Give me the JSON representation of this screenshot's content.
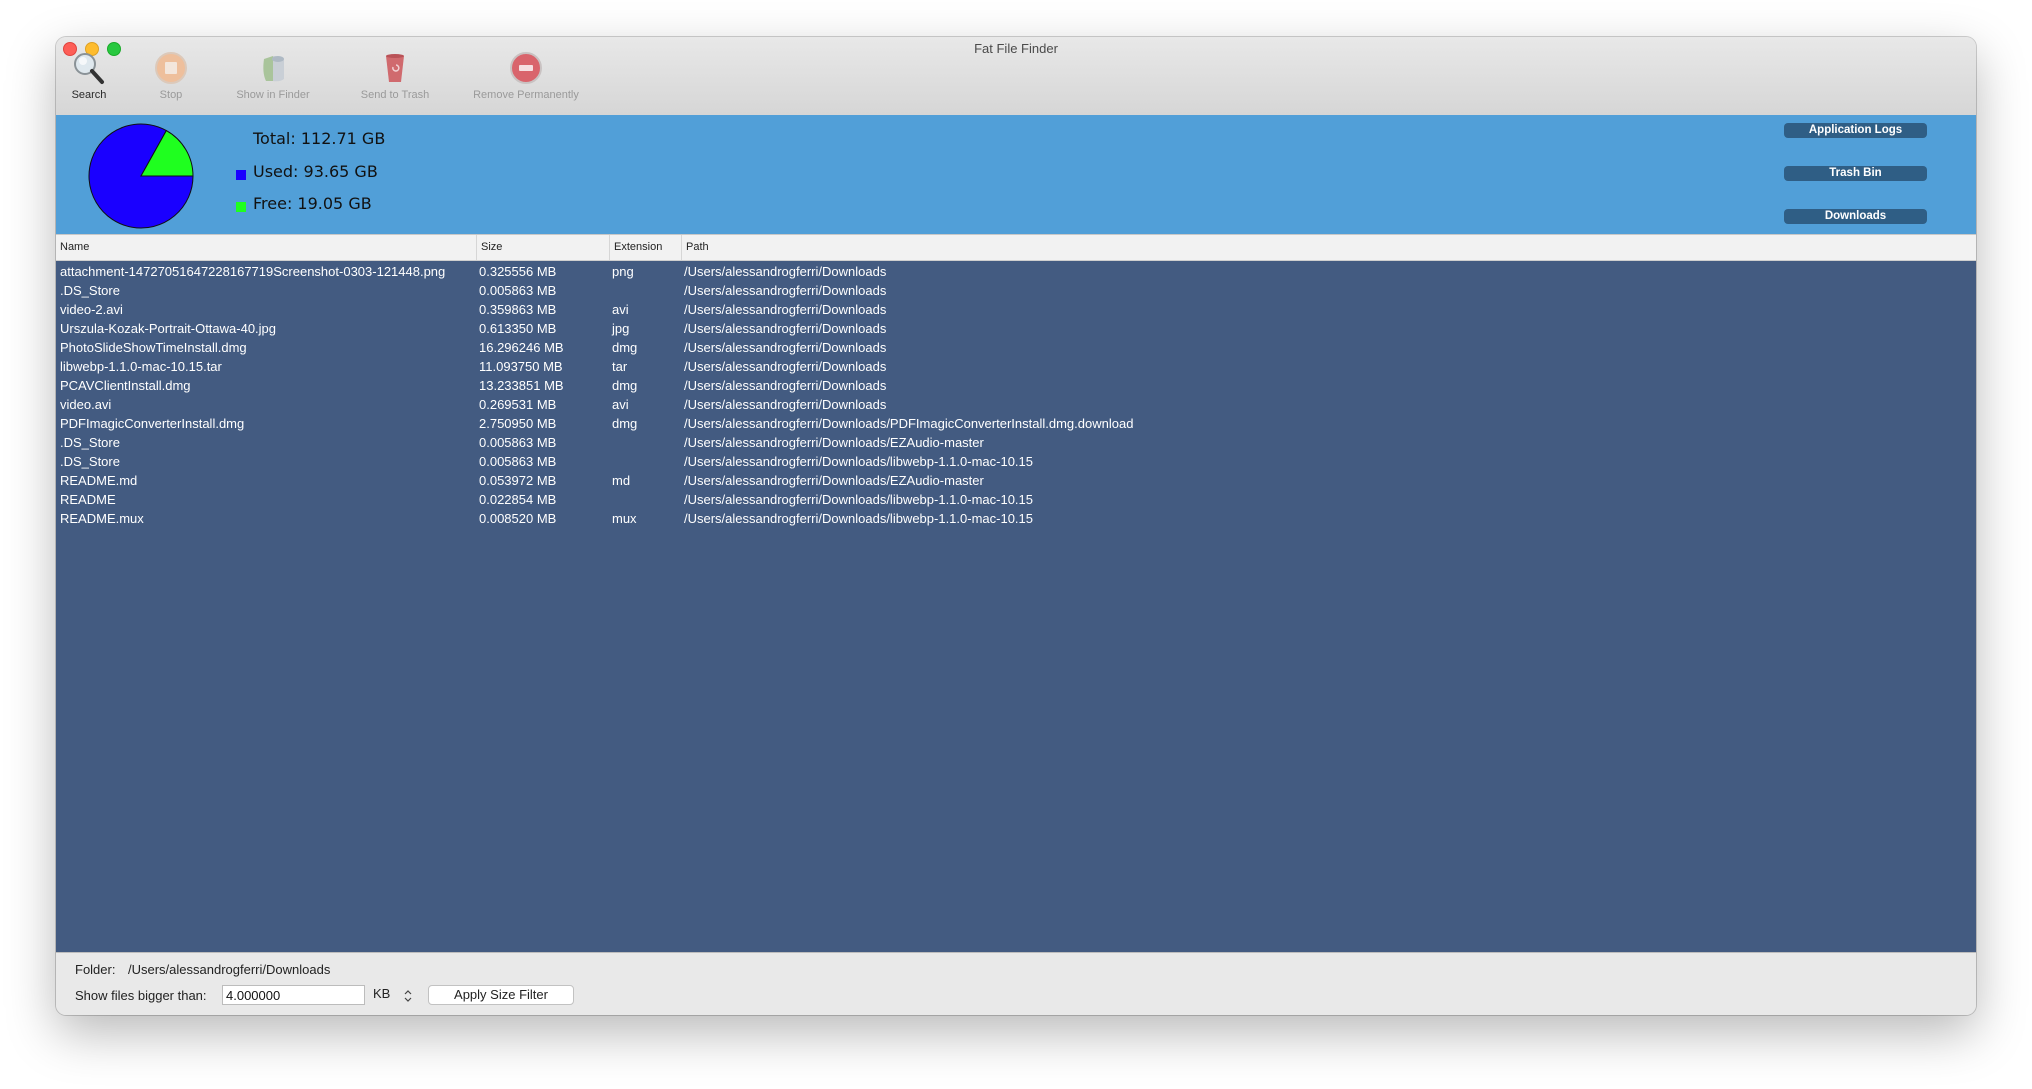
{
  "window": {
    "title": "Fat File Finder"
  },
  "toolbar": {
    "items": [
      {
        "label": "Search",
        "icon": "magnifier-icon",
        "enabled": true
      },
      {
        "label": "Stop",
        "icon": "stop-icon",
        "enabled": false
      },
      {
        "label": "Show in Finder",
        "icon": "finder-icon",
        "enabled": false
      },
      {
        "label": "Send to Trash",
        "icon": "trash-icon",
        "enabled": false
      },
      {
        "label": "Remove Permanently",
        "icon": "remove-icon",
        "enabled": false
      }
    ]
  },
  "disk": {
    "total_label": "Total: 112.71 GB",
    "used_label": "Used: 93.65 GB",
    "free_label": "Free: 19.05 GB",
    "total_gb": 112.71,
    "used_gb": 93.65,
    "free_gb": 19.05,
    "used_color": "#1a00ff",
    "free_color": "#1fff1f"
  },
  "shortcuts": [
    {
      "label": "Application Logs"
    },
    {
      "label": "Trash Bin"
    },
    {
      "label": "Downloads"
    }
  ],
  "table": {
    "columns": [
      "Name",
      "Size",
      "Extension",
      "Path"
    ],
    "rows": [
      {
        "name": "attachment-14727051647228167719Screenshot-0303-121448.png",
        "size": "0.325556 MB",
        "ext": "png",
        "path": "/Users/alessandrogferri/Downloads"
      },
      {
        "name": ".DS_Store",
        "size": "0.005863 MB",
        "ext": "",
        "path": "/Users/alessandrogferri/Downloads"
      },
      {
        "name": "video-2.avi",
        "size": "0.359863 MB",
        "ext": "avi",
        "path": "/Users/alessandrogferri/Downloads"
      },
      {
        "name": "Urszula-Kozak-Portrait-Ottawa-40.jpg",
        "size": "0.613350 MB",
        "ext": "jpg",
        "path": "/Users/alessandrogferri/Downloads"
      },
      {
        "name": "PhotoSlideShowTimeInstall.dmg",
        "size": "16.296246 MB",
        "ext": "dmg",
        "path": "/Users/alessandrogferri/Downloads"
      },
      {
        "name": "libwebp-1.1.0-mac-10.15.tar",
        "size": "11.093750 MB",
        "ext": "tar",
        "path": "/Users/alessandrogferri/Downloads"
      },
      {
        "name": "PCAVClientInstall.dmg",
        "size": "13.233851 MB",
        "ext": "dmg",
        "path": "/Users/alessandrogferri/Downloads"
      },
      {
        "name": "video.avi",
        "size": "0.269531 MB",
        "ext": "avi",
        "path": "/Users/alessandrogferri/Downloads"
      },
      {
        "name": "PDFImagicConverterInstall.dmg",
        "size": "2.750950 MB",
        "ext": "dmg",
        "path": "/Users/alessandrogferri/Downloads/PDFImagicConverterInstall.dmg.download"
      },
      {
        "name": ".DS_Store",
        "size": "0.005863 MB",
        "ext": "",
        "path": "/Users/alessandrogferri/Downloads/EZAudio-master"
      },
      {
        "name": ".DS_Store",
        "size": "0.005863 MB",
        "ext": "",
        "path": "/Users/alessandrogferri/Downloads/libwebp-1.1.0-mac-10.15"
      },
      {
        "name": "README.md",
        "size": "0.053972 MB",
        "ext": "md",
        "path": "/Users/alessandrogferri/Downloads/EZAudio-master"
      },
      {
        "name": "README",
        "size": "0.022854 MB",
        "ext": "",
        "path": "/Users/alessandrogferri/Downloads/libwebp-1.1.0-mac-10.15"
      },
      {
        "name": "README.mux",
        "size": "0.008520 MB",
        "ext": "mux",
        "path": "/Users/alessandrogferri/Downloads/libwebp-1.1.0-mac-10.15"
      }
    ]
  },
  "footer": {
    "folder_label": "Folder:",
    "folder_value": "/Users/alessandrogferri/Downloads",
    "size_label": "Show files bigger than:",
    "size_value": "4.000000",
    "unit": "KB",
    "apply_label": "Apply Size Filter"
  }
}
